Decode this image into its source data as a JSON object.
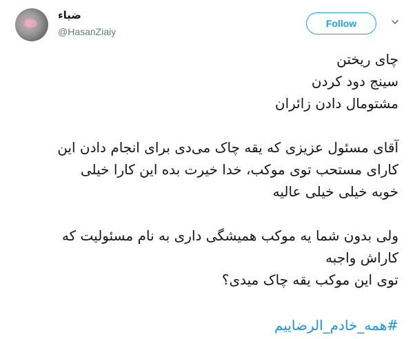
{
  "author": {
    "name": "ضیاء",
    "handle": "@HasanZiaiy"
  },
  "actions": {
    "follow_label": "Follow",
    "more_icon": "chevron-down-icon"
  },
  "tweet": {
    "lines_block1": [
      "چای ریختن",
      "سینج دود کردن",
      "مشتومال دادن زائران"
    ],
    "lines_block2": [
      "آقای مسئول عزیزی که یقه چاک می‌دی برای انجام دادن این",
      "کارای مستحب توی موکب، خدا خیرت بده این کارا خیلی",
      "خوبه خیلی خیلی عالیه"
    ],
    "lines_block3": [
      "ولی بدون شما یه موکب همیشگی داری به نام مسئولیت که",
      "کاراش واجبه",
      "توی این موکب یقه چاک میدی؟"
    ],
    "hashtag": "#همه_خادم_الرضاییم"
  },
  "colors": {
    "accent": "#1da1f2",
    "link": "#1b95e0",
    "text": "#14171a",
    "muted": "#657786"
  }
}
